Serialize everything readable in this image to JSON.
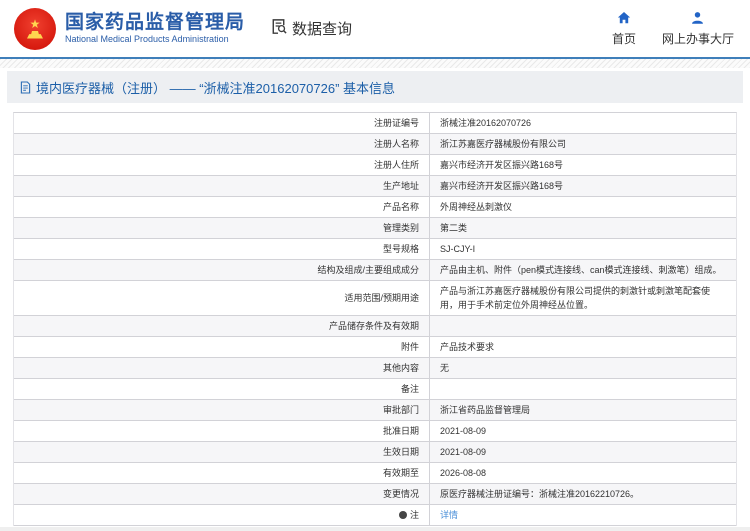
{
  "header": {
    "logo": {
      "icon": "national-emblem",
      "title": "国家药品监督管理局",
      "subtitle": "National Medical Products Administration"
    },
    "data_query": {
      "icon": "doc-search-icon",
      "label": "数据查询"
    },
    "nav": [
      {
        "icon": "home-icon",
        "label": "首页"
      },
      {
        "icon": "person-icon",
        "label": "网上办事大厅"
      }
    ]
  },
  "title_bar": {
    "icon": "document-icon",
    "text": "境内医疗器械（注册） —— “浙械注准20162070726” 基本信息"
  },
  "table": {
    "rows": [
      {
        "label": "注册证编号",
        "value": "浙械注准20162070726"
      },
      {
        "label": "注册人名称",
        "value": "浙江苏嘉医疗器械股份有限公司"
      },
      {
        "label": "注册人住所",
        "value": "嘉兴市经济开发区振兴路168号"
      },
      {
        "label": "生产地址",
        "value": "嘉兴市经济开发区振兴路168号"
      },
      {
        "label": "产品名称",
        "value": "外周神经丛刺激仪"
      },
      {
        "label": "管理类别",
        "value": "第二类"
      },
      {
        "label": "型号规格",
        "value": "SJ-CJY-I"
      },
      {
        "label": "结构及组成/主要组成成分",
        "value": "产品由主机、附件（pen模式连接线、can模式连接线、刺激笔）组成。"
      },
      {
        "label": "适用范围/预期用途",
        "value": "产品与浙江苏嘉医疗器械股份有限公司提供的刺激针或刺激笔配套使用，用于手术前定位外周神经丛位置。"
      },
      {
        "label": "产品储存条件及有效期",
        "value": ""
      },
      {
        "label": "附件",
        "value": "产品技术要求"
      },
      {
        "label": "其他内容",
        "value": "无"
      },
      {
        "label": "备注",
        "value": ""
      },
      {
        "label": "审批部门",
        "value": "浙江省药品监督管理局"
      },
      {
        "label": "批准日期",
        "value": "2021-08-09"
      },
      {
        "label": "生效日期",
        "value": "2021-08-09"
      },
      {
        "label": "有效期至",
        "value": "2026-08-08"
      },
      {
        "label": "变更情况",
        "value": "原医疗器械注册证编号：浙械注准20162210726。"
      },
      {
        "label": "注",
        "value": "详情",
        "link": true,
        "note_icon": true
      }
    ]
  },
  "colors": {
    "brand_blue": "#2a5da8",
    "titlebar_text_blue": "#1c5fa8",
    "top_rule_blue": "#3f7fba",
    "nav_icon_blue": "#2264c6",
    "link_blue": "#4a8fd8",
    "emblem_red": "#d6190e",
    "emblem_gold": "#ffd54f",
    "titlebar_bg": "#edeff2",
    "row_alt_bg": "#f6f6f8",
    "table_border": "#d2d2d7"
  }
}
